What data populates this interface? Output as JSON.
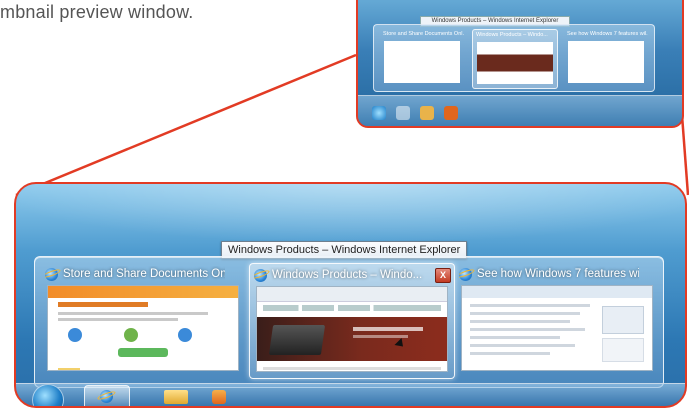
{
  "caption": "mbnail preview window.",
  "tooltip": "Windows Products – Windows Internet Explorer",
  "thumbnails": [
    {
      "title": "Store and Share Documents Onl...",
      "active": false
    },
    {
      "title": "Windows Products – Windo...",
      "active": true,
      "close_label": "X"
    },
    {
      "title": "See how Windows 7 features wil...",
      "active": false
    }
  ],
  "taskbar": {
    "items": [
      "start-button",
      "internet-explorer",
      "windows-explorer",
      "media-player"
    ]
  },
  "colors": {
    "highlight": "#e23b24",
    "desktop_blue": "#2d78b4"
  }
}
